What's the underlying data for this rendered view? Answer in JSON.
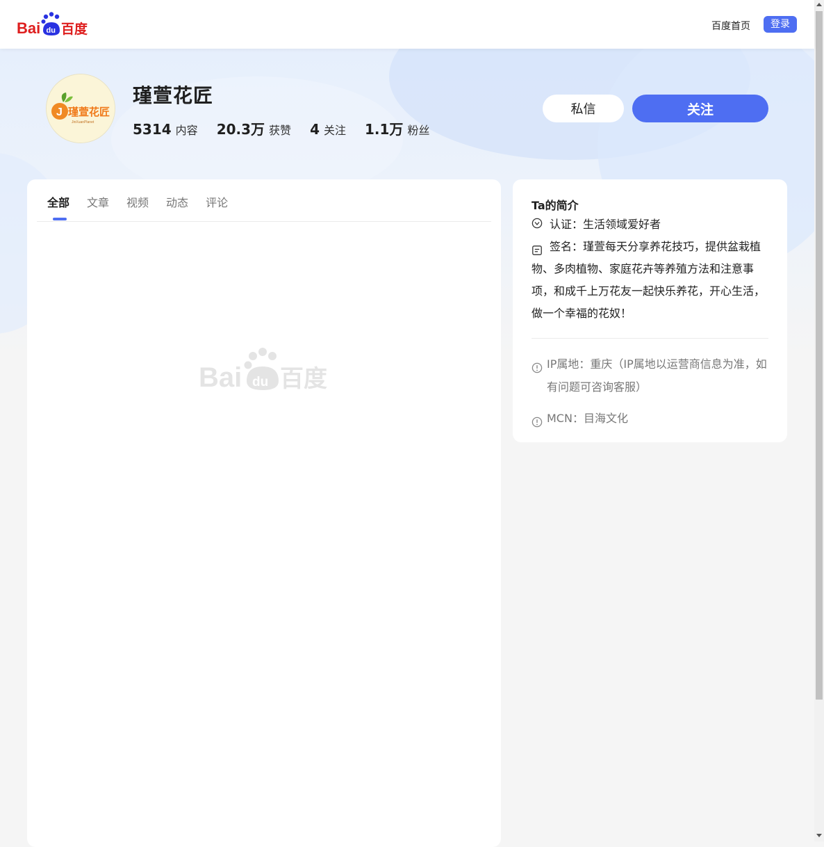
{
  "header": {
    "logo_text_latin": "Bai",
    "logo_text_du": "du",
    "logo_text_cn": "百度",
    "home_link": "百度首页",
    "login_button": "登录",
    "brand_color": "#4e6ef2",
    "logo_red": "#de1e1e",
    "logo_blue": "#2932e1"
  },
  "profile": {
    "avatar_brand_cn": "瑾萱花匠",
    "avatar_brand_en": "JinXuanPlanet",
    "avatar_letter": "J",
    "name": "瑾萱花匠",
    "stats": [
      {
        "num": "5314",
        "label": "内容"
      },
      {
        "num": "20.3万",
        "label": "获赞"
      },
      {
        "num": "4",
        "label": "关注"
      },
      {
        "num": "1.1万",
        "label": "粉丝"
      }
    ],
    "message_button": "私信",
    "follow_button": "关注"
  },
  "tabs": [
    {
      "label": "全部",
      "active": true
    },
    {
      "label": "文章",
      "active": false
    },
    {
      "label": "视频",
      "active": false
    },
    {
      "label": "动态",
      "active": false
    },
    {
      "label": "评论",
      "active": false
    }
  ],
  "intro": {
    "title": "Ta的简介",
    "verify_icon": "check-circle-icon",
    "verify_text": "认证：生活领域爱好者",
    "sign_icon": "note-icon",
    "sign_text": "签名：瑾萱每天分享养花技巧，提供盆栽植物、多肉植物、家庭花卉等养殖方法和注意事项，和成千上万花友一起快乐养花，开心生活，做一个幸福的花奴！",
    "info_icon": "info-circle-icon",
    "ip_text": "IP属地：重庆（IP属地以运营商信息为准，如有问题可咨询客服）",
    "mcn_text": "MCN：目海文化"
  }
}
